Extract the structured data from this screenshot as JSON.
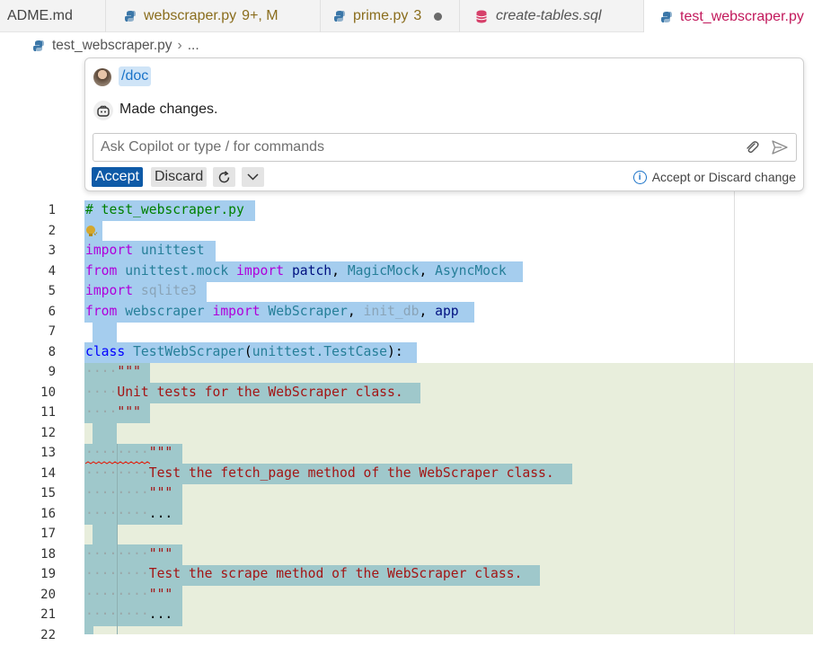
{
  "tabs": [
    {
      "label": "ADME.md"
    },
    {
      "label": "webscraper.py",
      "badge": "9+, M"
    },
    {
      "label": "prime.py",
      "badge": "3"
    },
    {
      "label": "create-tables.sql"
    },
    {
      "label": "test_webscraper.py"
    }
  ],
  "breadcrumb": {
    "file": "test_webscraper.py",
    "rest": "..."
  },
  "copilot": {
    "command": "/doc",
    "message": "Made changes.",
    "input_placeholder": "Ask Copilot or type / for commands",
    "accept_label": "Accept",
    "discard_label": "Discard",
    "hint": "Accept or Discard change"
  },
  "editor": {
    "line_numbers": [
      "1",
      "2",
      "3",
      "4",
      "5",
      "6",
      "7",
      "8",
      "9",
      "10",
      "11",
      "12",
      "13",
      "14",
      "15",
      "16",
      "17",
      "18",
      "19",
      "20",
      "21",
      "22"
    ],
    "line1": "# test_webscraper.py",
    "kw_import": "import",
    "kw_from": "from",
    "kw_class": "class",
    "mod_unittest": "unittest",
    "mod_unittest_mock": "unittest.mock",
    "names_patch": "patch",
    "names_magicmock": "MagicMock",
    "names_asyncmock": "AsyncMock",
    "mod_sqlite3": "sqlite3",
    "mod_webscraper": "webscraper",
    "names_webscraper": "WebScraper",
    "names_init_db": "init_db",
    "names_app": "app",
    "class_name": "TestWebScraper",
    "class_base": "unittest.TestCase",
    "doc_quote": "\"\"\"",
    "doc10": "Unit tests for the WebScraper class.",
    "doc14": "Test the fetch_page method of the WebScraper class.",
    "doc19": "Test the scrape method of the WebScraper class.",
    "ellipsis": "..."
  }
}
